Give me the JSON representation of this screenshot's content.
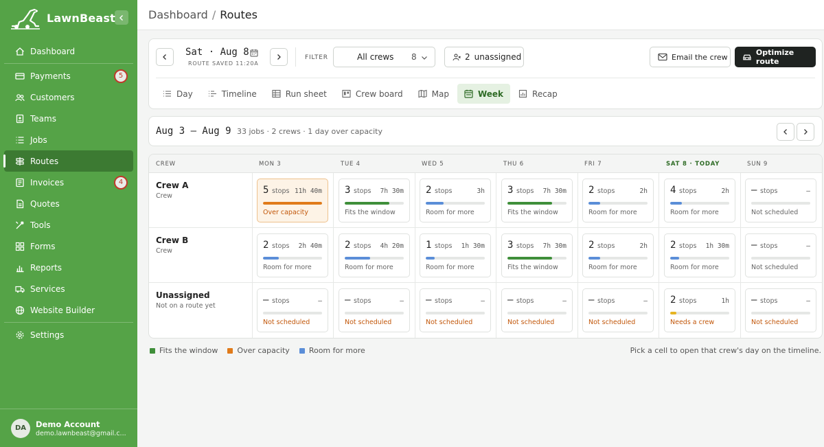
{
  "brand": {
    "name": "LawnBeast"
  },
  "sidebar": {
    "items": [
      {
        "label": "Dashboard",
        "icon": "home-icon"
      },
      {
        "label": "Payments",
        "icon": "credit-card-icon",
        "badge": "5"
      },
      {
        "label": "Customers",
        "icon": "users-icon"
      },
      {
        "label": "Teams",
        "icon": "id-badge-icon"
      },
      {
        "label": "Jobs",
        "icon": "list-icon"
      },
      {
        "label": "Routes",
        "icon": "signpost-icon",
        "active": true
      },
      {
        "label": "Invoices",
        "icon": "invoice-icon",
        "badge": "4"
      },
      {
        "label": "Quotes",
        "icon": "document-icon"
      },
      {
        "label": "Tools",
        "icon": "tools-icon"
      },
      {
        "label": "Forms",
        "icon": "grid-icon"
      },
      {
        "label": "Reports",
        "icon": "bar-chart-icon"
      },
      {
        "label": "Services",
        "icon": "truck-icon"
      },
      {
        "label": "Website Builder",
        "icon": "globe-icon"
      },
      {
        "label": "Settings",
        "icon": "gear-icon"
      }
    ]
  },
  "account": {
    "initials": "DA",
    "name": "Demo Account",
    "email": "demo.lawnbeast@gmail.c..."
  },
  "breadcrumb": {
    "root": "Dashboard",
    "sep": "/",
    "current": "Routes"
  },
  "controls": {
    "date": "Sat · Aug 8",
    "saved": "ROUTE SAVED 11:20A",
    "filter_label": "FILTER",
    "crew_select": {
      "value": "All crews",
      "count": "8"
    },
    "unassigned": {
      "count": "2",
      "label": "unassigned"
    },
    "email_label": "Email the crew",
    "optimize_label": "Optimize route"
  },
  "tabs": [
    {
      "label": "Day",
      "icon": "list-icon"
    },
    {
      "label": "Timeline",
      "icon": "timeline-icon"
    },
    {
      "label": "Run sheet",
      "icon": "table-icon"
    },
    {
      "label": "Crew board",
      "icon": "board-icon"
    },
    {
      "label": "Map",
      "icon": "map-icon"
    },
    {
      "label": "Week",
      "icon": "calendar-icon",
      "active": true
    },
    {
      "label": "Recap",
      "icon": "recap-icon"
    }
  ],
  "week": {
    "range": "Aug 3 – Aug 9",
    "summary": "33 jobs · 2 crews · 1 day over capacity"
  },
  "grid": {
    "crew_header": "CREW",
    "days": [
      "MON 3",
      "TUE 4",
      "WED 5",
      "THU 6",
      "FRI 7",
      "SAT 8 · TODAY",
      "SUN 9"
    ],
    "today_index": 5,
    "stops_word": "stops",
    "rows": [
      {
        "name": "Crew A",
        "sub": "Crew",
        "cells": [
          {
            "count": "5",
            "dur": "11h 40m",
            "status": "Over capacity",
            "fill": 1.0,
            "color": "#e07b1a",
            "over": true
          },
          {
            "count": "3",
            "dur": "7h 30m",
            "status": "Fits the window",
            "fill": 0.75,
            "color": "#3f8f3a"
          },
          {
            "count": "2",
            "dur": "3h",
            "status": "Room for more",
            "fill": 0.3,
            "color": "#5b8ed8"
          },
          {
            "count": "3",
            "dur": "7h 30m",
            "status": "Fits the window",
            "fill": 0.75,
            "color": "#3f8f3a"
          },
          {
            "count": "2",
            "dur": "2h",
            "status": "Room for more",
            "fill": 0.2,
            "color": "#5b8ed8"
          },
          {
            "count": "4",
            "dur": "2h",
            "status": "Room for more",
            "fill": 0.2,
            "color": "#5b8ed8"
          },
          {
            "count": "–",
            "dur": "–",
            "status": "Not scheduled",
            "fill": 0,
            "color": "#5b8ed8"
          }
        ]
      },
      {
        "name": "Crew B",
        "sub": "Crew",
        "cells": [
          {
            "count": "2",
            "dur": "2h 40m",
            "status": "Room for more",
            "fill": 0.27,
            "color": "#5b8ed8"
          },
          {
            "count": "2",
            "dur": "4h 20m",
            "status": "Room for more",
            "fill": 0.43,
            "color": "#5b8ed8"
          },
          {
            "count": "1",
            "dur": "1h 30m",
            "status": "Room for more",
            "fill": 0.15,
            "color": "#5b8ed8"
          },
          {
            "count": "3",
            "dur": "7h 30m",
            "status": "Fits the window",
            "fill": 0.75,
            "color": "#3f8f3a"
          },
          {
            "count": "2",
            "dur": "2h",
            "status": "Room for more",
            "fill": 0.2,
            "color": "#5b8ed8"
          },
          {
            "count": "2",
            "dur": "1h 30m",
            "status": "Room for more",
            "fill": 0.15,
            "color": "#5b8ed8"
          },
          {
            "count": "–",
            "dur": "–",
            "status": "Not scheduled",
            "fill": 0,
            "color": "#5b8ed8"
          }
        ]
      },
      {
        "name": "Unassigned",
        "sub": "Not on a route yet",
        "cells": [
          {
            "count": "–",
            "dur": "–",
            "status": "Not scheduled",
            "fill": 0,
            "color": "#5b8ed8",
            "warn": true
          },
          {
            "count": "–",
            "dur": "–",
            "status": "Not scheduled",
            "fill": 0,
            "color": "#5b8ed8",
            "warn": true
          },
          {
            "count": "–",
            "dur": "–",
            "status": "Not scheduled",
            "fill": 0,
            "color": "#5b8ed8",
            "warn": true
          },
          {
            "count": "–",
            "dur": "–",
            "status": "Not scheduled",
            "fill": 0,
            "color": "#5b8ed8",
            "warn": true
          },
          {
            "count": "–",
            "dur": "–",
            "status": "Not scheduled",
            "fill": 0,
            "color": "#5b8ed8",
            "warn": true
          },
          {
            "count": "2",
            "dur": "1h",
            "status": "Needs a crew",
            "fill": 0.1,
            "color": "#e6b422",
            "warn": true
          },
          {
            "count": "–",
            "dur": "–",
            "status": "Not scheduled",
            "fill": 0,
            "color": "#5b8ed8",
            "warn": true
          }
        ]
      }
    ]
  },
  "legend": [
    {
      "label": "Fits the window",
      "color": "#3f8f3a"
    },
    {
      "label": "Over capacity",
      "color": "#e07b1a"
    },
    {
      "label": "Room for more",
      "color": "#5b8ed8"
    }
  ],
  "hint": "Pick a cell to open that crew's day on the timeline."
}
